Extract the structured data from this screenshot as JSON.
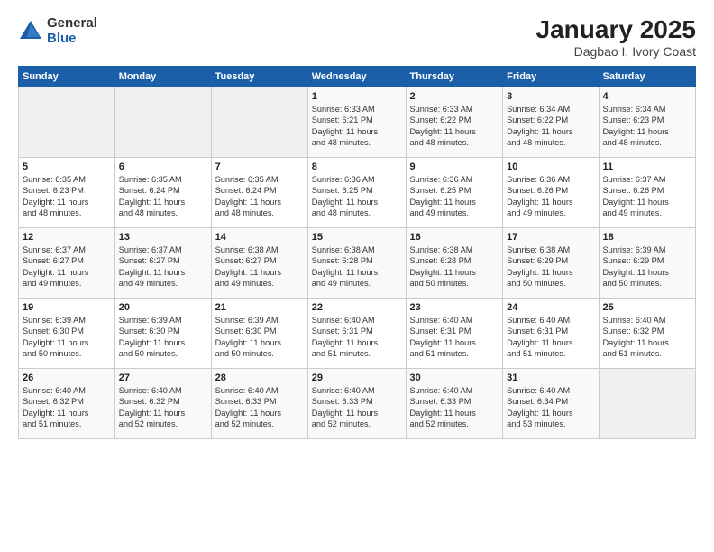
{
  "logo": {
    "general": "General",
    "blue": "Blue"
  },
  "title": "January 2025",
  "subtitle": "Dagbao I, Ivory Coast",
  "weekdays": [
    "Sunday",
    "Monday",
    "Tuesday",
    "Wednesday",
    "Thursday",
    "Friday",
    "Saturday"
  ],
  "weeks": [
    [
      {
        "day": "",
        "info": ""
      },
      {
        "day": "",
        "info": ""
      },
      {
        "day": "",
        "info": ""
      },
      {
        "day": "1",
        "info": "Sunrise: 6:33 AM\nSunset: 6:21 PM\nDaylight: 11 hours\nand 48 minutes."
      },
      {
        "day": "2",
        "info": "Sunrise: 6:33 AM\nSunset: 6:22 PM\nDaylight: 11 hours\nand 48 minutes."
      },
      {
        "day": "3",
        "info": "Sunrise: 6:34 AM\nSunset: 6:22 PM\nDaylight: 11 hours\nand 48 minutes."
      },
      {
        "day": "4",
        "info": "Sunrise: 6:34 AM\nSunset: 6:23 PM\nDaylight: 11 hours\nand 48 minutes."
      }
    ],
    [
      {
        "day": "5",
        "info": "Sunrise: 6:35 AM\nSunset: 6:23 PM\nDaylight: 11 hours\nand 48 minutes."
      },
      {
        "day": "6",
        "info": "Sunrise: 6:35 AM\nSunset: 6:24 PM\nDaylight: 11 hours\nand 48 minutes."
      },
      {
        "day": "7",
        "info": "Sunrise: 6:35 AM\nSunset: 6:24 PM\nDaylight: 11 hours\nand 48 minutes."
      },
      {
        "day": "8",
        "info": "Sunrise: 6:36 AM\nSunset: 6:25 PM\nDaylight: 11 hours\nand 48 minutes."
      },
      {
        "day": "9",
        "info": "Sunrise: 6:36 AM\nSunset: 6:25 PM\nDaylight: 11 hours\nand 49 minutes."
      },
      {
        "day": "10",
        "info": "Sunrise: 6:36 AM\nSunset: 6:26 PM\nDaylight: 11 hours\nand 49 minutes."
      },
      {
        "day": "11",
        "info": "Sunrise: 6:37 AM\nSunset: 6:26 PM\nDaylight: 11 hours\nand 49 minutes."
      }
    ],
    [
      {
        "day": "12",
        "info": "Sunrise: 6:37 AM\nSunset: 6:27 PM\nDaylight: 11 hours\nand 49 minutes."
      },
      {
        "day": "13",
        "info": "Sunrise: 6:37 AM\nSunset: 6:27 PM\nDaylight: 11 hours\nand 49 minutes."
      },
      {
        "day": "14",
        "info": "Sunrise: 6:38 AM\nSunset: 6:27 PM\nDaylight: 11 hours\nand 49 minutes."
      },
      {
        "day": "15",
        "info": "Sunrise: 6:38 AM\nSunset: 6:28 PM\nDaylight: 11 hours\nand 49 minutes."
      },
      {
        "day": "16",
        "info": "Sunrise: 6:38 AM\nSunset: 6:28 PM\nDaylight: 11 hours\nand 50 minutes."
      },
      {
        "day": "17",
        "info": "Sunrise: 6:38 AM\nSunset: 6:29 PM\nDaylight: 11 hours\nand 50 minutes."
      },
      {
        "day": "18",
        "info": "Sunrise: 6:39 AM\nSunset: 6:29 PM\nDaylight: 11 hours\nand 50 minutes."
      }
    ],
    [
      {
        "day": "19",
        "info": "Sunrise: 6:39 AM\nSunset: 6:30 PM\nDaylight: 11 hours\nand 50 minutes."
      },
      {
        "day": "20",
        "info": "Sunrise: 6:39 AM\nSunset: 6:30 PM\nDaylight: 11 hours\nand 50 minutes."
      },
      {
        "day": "21",
        "info": "Sunrise: 6:39 AM\nSunset: 6:30 PM\nDaylight: 11 hours\nand 50 minutes."
      },
      {
        "day": "22",
        "info": "Sunrise: 6:40 AM\nSunset: 6:31 PM\nDaylight: 11 hours\nand 51 minutes."
      },
      {
        "day": "23",
        "info": "Sunrise: 6:40 AM\nSunset: 6:31 PM\nDaylight: 11 hours\nand 51 minutes."
      },
      {
        "day": "24",
        "info": "Sunrise: 6:40 AM\nSunset: 6:31 PM\nDaylight: 11 hours\nand 51 minutes."
      },
      {
        "day": "25",
        "info": "Sunrise: 6:40 AM\nSunset: 6:32 PM\nDaylight: 11 hours\nand 51 minutes."
      }
    ],
    [
      {
        "day": "26",
        "info": "Sunrise: 6:40 AM\nSunset: 6:32 PM\nDaylight: 11 hours\nand 51 minutes."
      },
      {
        "day": "27",
        "info": "Sunrise: 6:40 AM\nSunset: 6:32 PM\nDaylight: 11 hours\nand 52 minutes."
      },
      {
        "day": "28",
        "info": "Sunrise: 6:40 AM\nSunset: 6:33 PM\nDaylight: 11 hours\nand 52 minutes."
      },
      {
        "day": "29",
        "info": "Sunrise: 6:40 AM\nSunset: 6:33 PM\nDaylight: 11 hours\nand 52 minutes."
      },
      {
        "day": "30",
        "info": "Sunrise: 6:40 AM\nSunset: 6:33 PM\nDaylight: 11 hours\nand 52 minutes."
      },
      {
        "day": "31",
        "info": "Sunrise: 6:40 AM\nSunset: 6:34 PM\nDaylight: 11 hours\nand 53 minutes."
      },
      {
        "day": "",
        "info": ""
      }
    ]
  ]
}
